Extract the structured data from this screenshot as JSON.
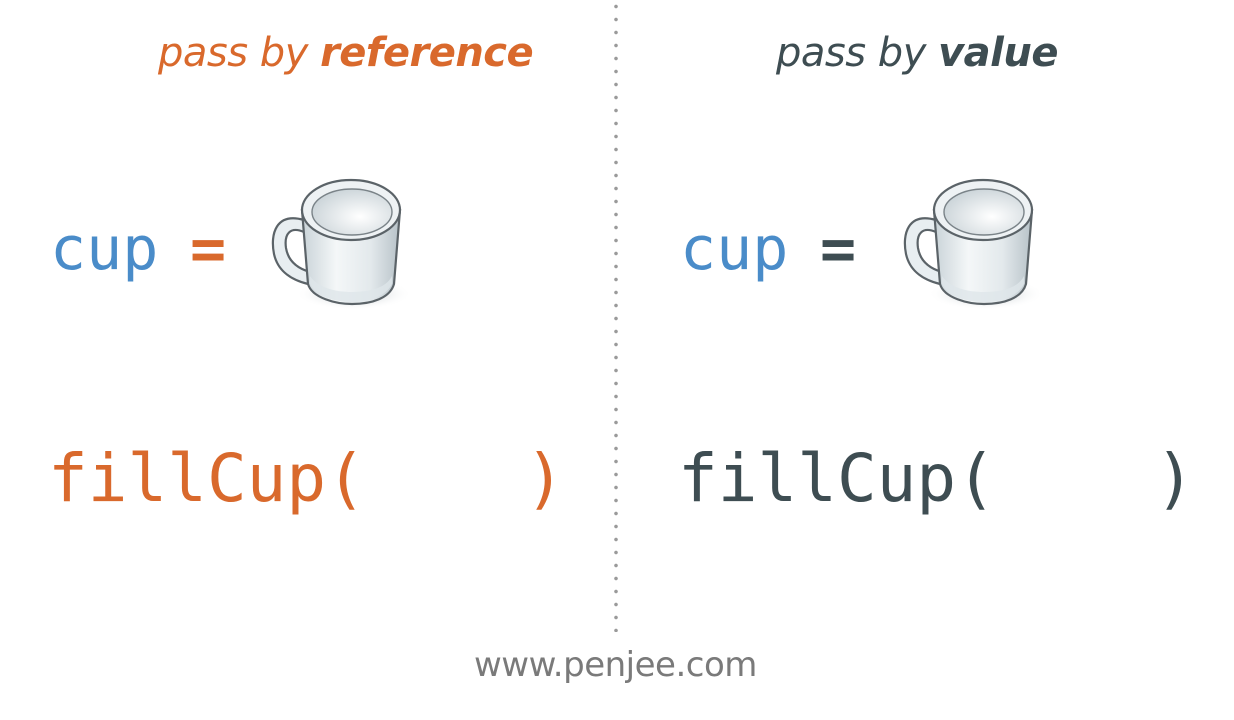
{
  "left_panel": {
    "heading_prefix": "pass by ",
    "heading_emphasis": "reference",
    "variable": "cup",
    "assign_op": "=",
    "call_open": "fillCup(",
    "call_close": ")",
    "cup_icon": "mug-icon"
  },
  "right_panel": {
    "heading_prefix": "pass by ",
    "heading_emphasis": "value",
    "variable": "cup",
    "assign_op": "=",
    "call_open": "fillCup(",
    "call_close": ")",
    "cup_icon": "mug-icon"
  },
  "footer": {
    "url": "www.penjee.com"
  },
  "colors": {
    "reference_accent": "#d9692c",
    "value_accent": "#3e4d52",
    "variable_blue": "#4a8cc9",
    "divider": "#9a9a9a",
    "footer_text": "#7a7a7a"
  }
}
